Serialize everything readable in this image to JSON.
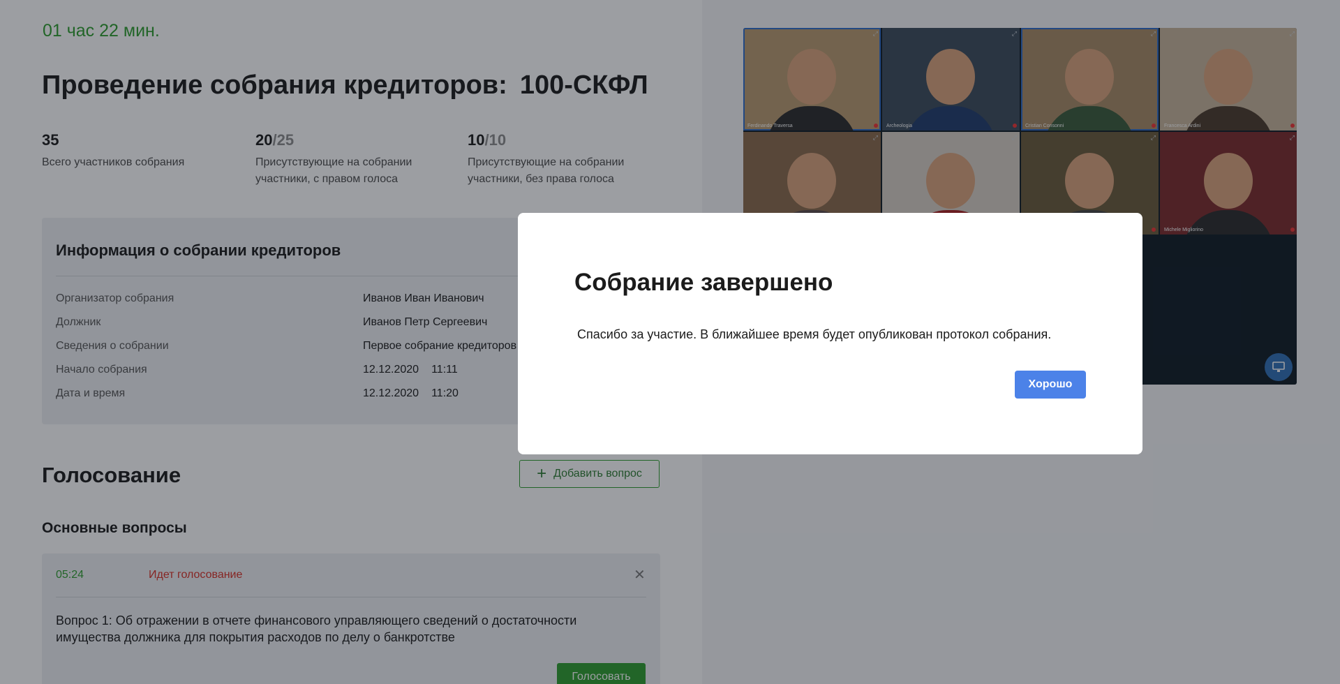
{
  "header": {
    "elapsed_time": "01 час 22 мин.",
    "title": "Проведение собрания кредиторов:",
    "code": "100-СКФЛ"
  },
  "stats": [
    {
      "value": "35",
      "total": "",
      "label": "Всего участников собрания"
    },
    {
      "value": "20",
      "total": "/25",
      "label": "Присутствующие на собрании участники, с правом голоса"
    },
    {
      "value": "10",
      "total": "/10",
      "label": "Присутствующие на собрании участники, без права голоса"
    }
  ],
  "info": {
    "title": "Информация о собрании кредиторов",
    "rows": [
      {
        "label": "Организатор собрания",
        "value": "Иванов Иван Иванович",
        "time": ""
      },
      {
        "label": "Должник",
        "value": "Иванов Петр Сергеевич",
        "time": ""
      },
      {
        "label": "Сведения о собрании",
        "value": "Первое собрание кредиторов",
        "time": ""
      },
      {
        "label": "Начало собрания",
        "value": "12.12.2020",
        "time": "11:11"
      },
      {
        "label": "Дата и время",
        "value": "12.12.2020",
        "time": "11:20"
      }
    ]
  },
  "voting": {
    "title": "Голосование",
    "add_button": "Добавить вопрос",
    "section_title": "Основные вопросы",
    "question": {
      "timer": "05:24",
      "status": "Идет голосование",
      "text": "Вопрос 1: Об отражении в отчете финансового управляющего сведений о достаточности имущества должника для покрытия расходов по делу о банкротстве",
      "vote_button": "Голосовать"
    }
  },
  "video": {
    "tiles": [
      {
        "name": "Ferdinando Traversa",
        "bg": "#b89a6e",
        "shirt": "#2a2a2a",
        "active": true
      },
      {
        "name": "Archeologia",
        "bg": "#3b4a5a",
        "shirt": "#1f3b6b",
        "active": false
      },
      {
        "name": "Cristian Consonni",
        "bg": "#a88a64",
        "shirt": "#3a5a3a",
        "active": true
      },
      {
        "name": "Francesca Ardini",
        "bg": "#c7b49a",
        "shirt": "#4a3a2a",
        "active": false
      },
      {
        "name": "",
        "bg": "#8a6a4a",
        "shirt": "#5a4a4a",
        "active": false
      },
      {
        "name": "",
        "bg": "#d8cfc4",
        "shirt": "#aa2222",
        "active": false
      },
      {
        "name": "",
        "bg": "#6a5a3a",
        "shirt": "#444444",
        "active": false
      },
      {
        "name": "Michele Migliorino",
        "bg": "#7a2a2a",
        "shirt": "#2a2a2a",
        "active": false
      }
    ]
  },
  "modal": {
    "title": "Собрание завершено",
    "text": "Спасибо за участие. В ближайшее время будет опубликован протокол собрания.",
    "ok_button": "Хорошо"
  },
  "colors": {
    "accent_green": "#2e9e2e",
    "status_red": "#d93025",
    "primary_blue": "#4c82e8"
  }
}
